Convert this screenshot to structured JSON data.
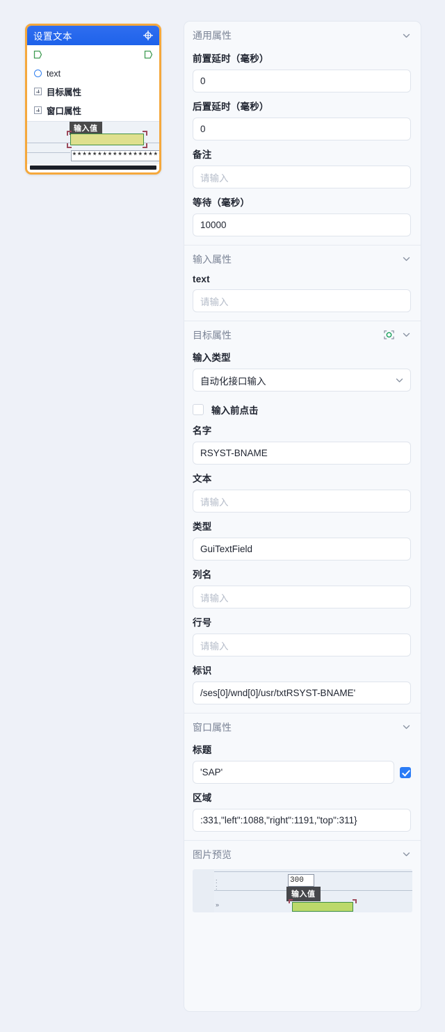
{
  "node": {
    "title": "设置文本",
    "header_icon": "crosshair-target-icon",
    "port_left": "port-left",
    "port_right": "port-right",
    "rows": [
      {
        "icon": "circle-output-icon",
        "label": "text"
      },
      {
        "icon": "expand-plus-icon",
        "label": "目标属性"
      },
      {
        "icon": "expand-plus-icon",
        "label": "窗口属性"
      }
    ],
    "thumbnail": {
      "tooltip": "输入值",
      "password_text": "*********************"
    }
  },
  "panel": {
    "sections": [
      {
        "id": "general",
        "title": "通用属性",
        "collapse_icon": "chevron-down-icon",
        "fields": [
          {
            "id": "pre_delay",
            "label": "前置延时（毫秒）",
            "value": "0",
            "placeholder": "请输入",
            "type": "text"
          },
          {
            "id": "post_delay",
            "label": "后置延时（毫秒）",
            "value": "0",
            "placeholder": "请输入",
            "type": "text"
          },
          {
            "id": "remark",
            "label": "备注",
            "value": "",
            "placeholder": "请输入",
            "type": "text"
          },
          {
            "id": "wait",
            "label": "等待（毫秒）",
            "value": "10000",
            "placeholder": "请输入",
            "type": "text"
          }
        ]
      },
      {
        "id": "input",
        "title": "输入属性",
        "collapse_icon": "chevron-down-icon",
        "fields": [
          {
            "id": "text",
            "label": "text",
            "value": "",
            "placeholder": "请输入",
            "type": "text"
          }
        ]
      },
      {
        "id": "target",
        "title": "目标属性",
        "collapse_icon": "chevron-down-icon",
        "capture_icon": "screen-capture-icon",
        "fields": [
          {
            "id": "input_type",
            "label": "输入类型",
            "value": "自动化接口输入",
            "type": "select",
            "options": [
              "自动化接口输入"
            ]
          },
          {
            "id": "click_before_input",
            "label": "输入前点击",
            "type": "checkbox",
            "checked": false
          },
          {
            "id": "name",
            "label": "名字",
            "value": "RSYST-BNAME",
            "placeholder": "请输入",
            "type": "text"
          },
          {
            "id": "text2",
            "label": "文本",
            "value": "",
            "placeholder": "请输入",
            "type": "text"
          },
          {
            "id": "type",
            "label": "类型",
            "value": "GuiTextField",
            "placeholder": "请输入",
            "type": "text"
          },
          {
            "id": "column",
            "label": "列名",
            "value": "",
            "placeholder": "请输入",
            "type": "text"
          },
          {
            "id": "rownum",
            "label": "行号",
            "value": "",
            "placeholder": "请输入",
            "type": "text"
          },
          {
            "id": "ident",
            "label": "标识",
            "value": "/ses[0]/wnd[0]/usr/txtRSYST-BNAME'",
            "placeholder": "请输入",
            "type": "text"
          }
        ]
      },
      {
        "id": "window",
        "title": "窗口属性",
        "collapse_icon": "chevron-down-icon",
        "fields": [
          {
            "id": "win_title",
            "label": "标题",
            "value": "'SAP'",
            "placeholder": "请输入",
            "type": "text_with_checkbox",
            "checked": true
          },
          {
            "id": "region",
            "label": "区域",
            "value": ":331,\"left\":1088,\"right\":1191,\"top\":311}",
            "placeholder": "请输入",
            "type": "text"
          }
        ]
      },
      {
        "id": "preview",
        "title": "图片预览",
        "collapse_icon": "chevron-down-icon",
        "image": {
          "box_text": "300",
          "tooltip": "输入值"
        }
      }
    ]
  },
  "colors": {
    "canvas": "#eef1f8",
    "node_border": "#f5a83c",
    "node_header": "#1e62ea",
    "accent_blue": "#2b7cf6",
    "capture_green": "#3f8f45",
    "panel_bg": "#f7f9fc"
  }
}
